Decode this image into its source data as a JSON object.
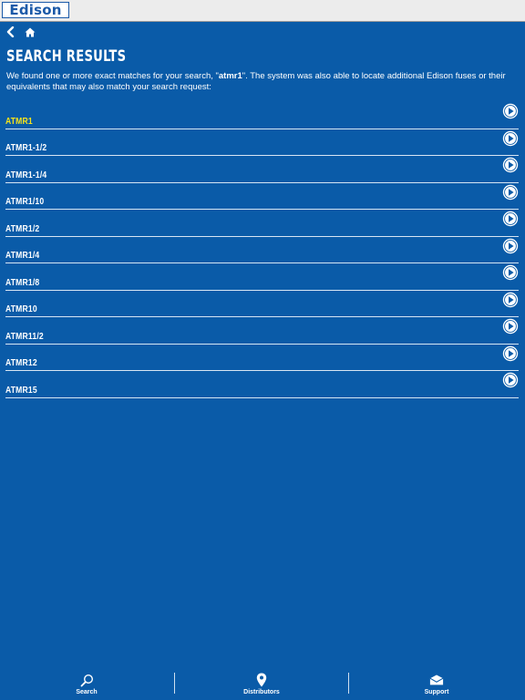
{
  "header": {
    "logo_text": "Edison"
  },
  "nav": {
    "back_icon": "chevron-left-icon",
    "home_icon": "home-icon"
  },
  "page": {
    "title": "SEARCH RESULTS",
    "desc_before": "We found one or more exact matches for your search, \"",
    "desc_query": "atmr1",
    "desc_after": "\". The system was also able to locate additional Edison fuses or their equivalents that may also match your search request:"
  },
  "results": [
    {
      "label": "ATMR1",
      "highlight": true
    },
    {
      "label": "ATMR1-1/2"
    },
    {
      "label": "ATMR1-1/4"
    },
    {
      "label": "ATMR1/10"
    },
    {
      "label": "ATMR1/2"
    },
    {
      "label": "ATMR1/4"
    },
    {
      "label": "ATMR1/8"
    },
    {
      "label": "ATMR10"
    },
    {
      "label": "ATMR11/2"
    },
    {
      "label": "ATMR12"
    },
    {
      "label": "ATMR15"
    }
  ],
  "tabs": [
    {
      "label": "Search",
      "icon": "search-icon"
    },
    {
      "label": "Distributors",
      "icon": "location-pin-icon"
    },
    {
      "label": "Support",
      "icon": "envelope-icon"
    }
  ],
  "colors": {
    "background": "#0a5ba8",
    "highlight": "#f7e41a",
    "topbar": "#ececec",
    "logo": "#1c5aa8"
  }
}
